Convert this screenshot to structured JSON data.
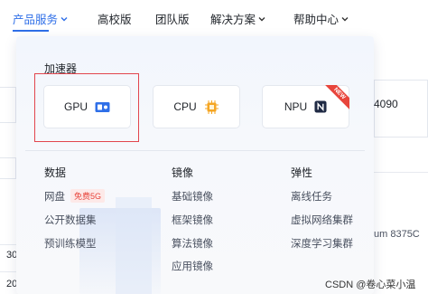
{
  "nav": {
    "items": [
      {
        "label": "产品服务",
        "has_chevron": true,
        "active": true
      },
      {
        "label": "高校版",
        "has_chevron": false
      },
      {
        "label": "团队版",
        "has_chevron": false
      },
      {
        "label": "解决方案",
        "has_chevron": true
      },
      {
        "label": "帮助中心",
        "has_chevron": true
      }
    ]
  },
  "background": {
    "fragment_4090": "4090",
    "fragment_cpu": "um 8375C",
    "fragment_30": "30",
    "fragment_20": "20"
  },
  "dropdown": {
    "accelerator_title": "加速器",
    "cards": [
      {
        "label": "GPU",
        "icon": "gpu-chip-icon",
        "selected": true
      },
      {
        "label": "CPU",
        "icon": "cpu-chip-icon"
      },
      {
        "label": "NPU",
        "icon": "npu-chip-icon",
        "ribbon": "NEW"
      }
    ],
    "columns": [
      {
        "heading": "数据",
        "items": [
          {
            "label": "网盘",
            "badge": "免费5G"
          },
          {
            "label": "公开数据集"
          },
          {
            "label": "预训练模型"
          }
        ]
      },
      {
        "heading": "镜像",
        "items": [
          {
            "label": "基础镜像"
          },
          {
            "label": "框架镜像"
          },
          {
            "label": "算法镜像"
          },
          {
            "label": "应用镜像"
          }
        ]
      },
      {
        "heading": "弹性",
        "items": [
          {
            "label": "离线任务"
          },
          {
            "label": "虚拟网络集群"
          },
          {
            "label": "深度学习集群"
          }
        ]
      }
    ]
  },
  "watermark": "CSDN @卷心菜小温",
  "colors": {
    "accent": "#2f6fe8",
    "highlight": "#e2454d",
    "badge_text": "#e8453c",
    "chip_orange": "#f5a623"
  }
}
